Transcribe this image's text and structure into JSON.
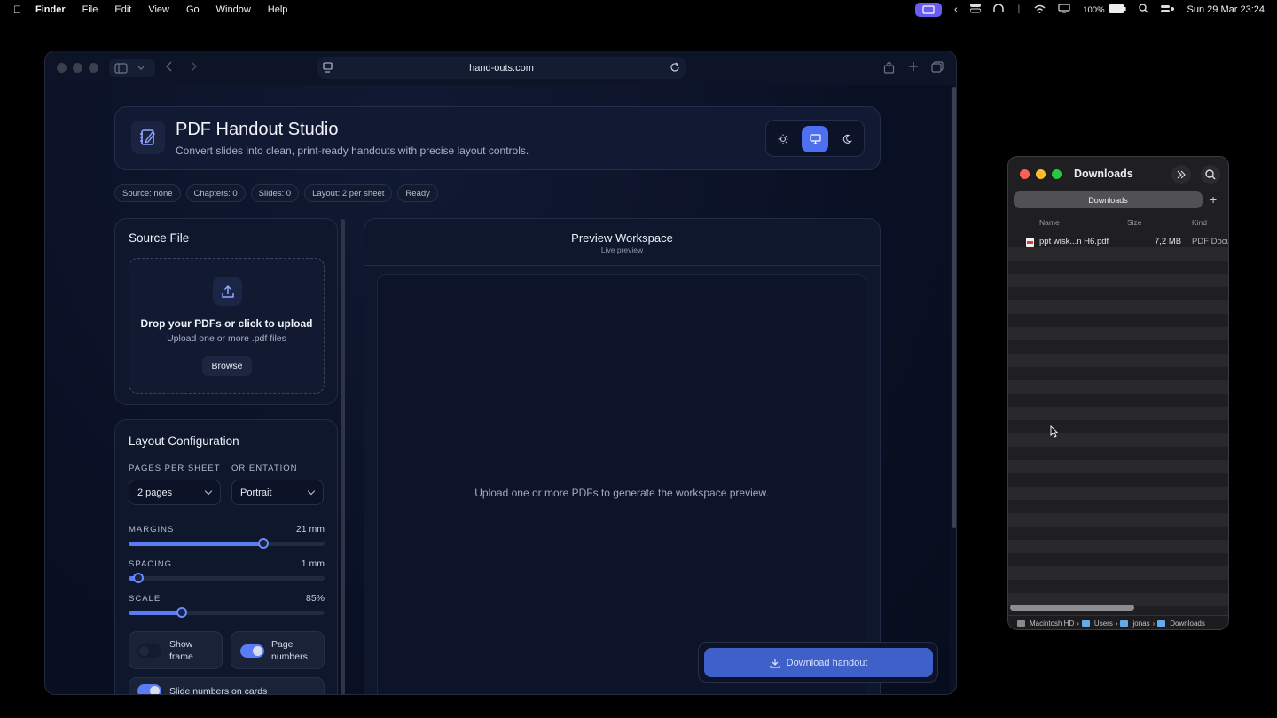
{
  "menubar": {
    "app": "Finder",
    "items": [
      "File",
      "Edit",
      "View",
      "Go",
      "Window",
      "Help"
    ],
    "battery": "100%",
    "datetime": "Sun 29 Mar  23:24"
  },
  "browser": {
    "url": "hand-outs.com"
  },
  "header": {
    "title": "PDF Handout Studio",
    "subtitle": "Convert slides into clean, print-ready handouts with precise layout controls."
  },
  "status_chips": [
    "Source: none",
    "Chapters: 0",
    "Slides: 0",
    "Layout: 2 per sheet",
    "Ready"
  ],
  "source": {
    "title": "Source File",
    "drop_title": "Drop your PDFs or click to upload",
    "drop_sub": "Upload one or more .pdf files",
    "browse": "Browse"
  },
  "layout": {
    "title": "Layout Configuration",
    "pages_label": "PAGES PER SHEET",
    "pages_value": "2 pages",
    "orientation_label": "ORIENTATION",
    "orientation_value": "Portrait",
    "margins_label": "MARGINS",
    "margins_value": "21 mm",
    "margins_fraction": 0.69,
    "spacing_label": "SPACING",
    "spacing_value": "1 mm",
    "spacing_fraction": 0.05,
    "scale_label": "SCALE",
    "scale_value": "85%",
    "scale_fraction": 0.27,
    "show_frame": "Show\nframe",
    "show_frame_on": false,
    "page_numbers": "Page\nnumbers",
    "page_numbers_on": true,
    "slide_numbers": "Slide numbers on cards",
    "slide_numbers_on": true
  },
  "preview": {
    "title": "Preview Workspace",
    "subtitle": "Live preview",
    "empty": "Upload one or more PDFs to generate the workspace preview."
  },
  "download": {
    "label": "Download handout"
  },
  "finder": {
    "title": "Downloads",
    "tab": "Downloads",
    "col_name": "Name",
    "col_size": "Size",
    "col_kind": "Kind",
    "file": {
      "name": "ppt wisk...n H6.pdf",
      "size": "7,2 MB",
      "kind": "PDF Docu"
    },
    "path": [
      "Macintosh HD",
      "Users",
      "jonas",
      "Downloads"
    ]
  },
  "colors": {
    "accent": "#5b7cf5",
    "page_bg": "#0a1024",
    "finder_bg": "#1f1f21"
  }
}
